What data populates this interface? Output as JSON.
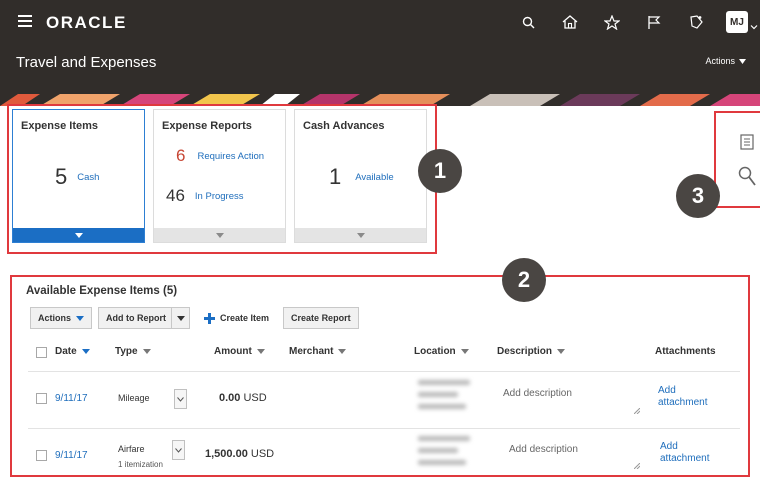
{
  "header": {
    "logo": "ORACLE",
    "page_title": "Travel and Expenses",
    "actions_label": "Actions",
    "avatar_initials": "MJ"
  },
  "cards": [
    {
      "title": "Expense Items",
      "metrics": [
        {
          "value": "5",
          "label": "Cash"
        }
      ]
    },
    {
      "title": "Expense Reports",
      "metrics": [
        {
          "value": "6",
          "label": "Requires Action"
        },
        {
          "value": "46",
          "label": "In Progress"
        }
      ]
    },
    {
      "title": "Cash Advances",
      "metrics": [
        {
          "value": "1",
          "label": "Available"
        }
      ]
    }
  ],
  "callouts": [
    "1",
    "2",
    "3"
  ],
  "section": {
    "title": "Available Expense Items (5)",
    "toolbar": {
      "actions": "Actions",
      "add_to_report": "Add to Report",
      "create_item": "Create Item",
      "create_report": "Create Report"
    },
    "columns": [
      "Date",
      "Type",
      "Amount",
      "Merchant",
      "Location",
      "Description",
      "Attachments"
    ],
    "rows": [
      {
        "date": "9/11/17",
        "type": "Mileage",
        "subtype": "",
        "amount": "0.00",
        "currency": "USD",
        "description": "Add description",
        "attachment": "Add attachment"
      },
      {
        "date": "9/11/17",
        "type": "Airfare",
        "subtype": "1 itemization",
        "amount": "1,500.00",
        "currency": "USD",
        "description": "Add description",
        "attachment": "Add attachment"
      }
    ]
  },
  "colors": {
    "header_bg": "#312d2a",
    "accent_blue": "#1b6ec4",
    "link": "#1f6ebc",
    "callout_red": "#e0393e",
    "alert_orange": "#c74634"
  }
}
